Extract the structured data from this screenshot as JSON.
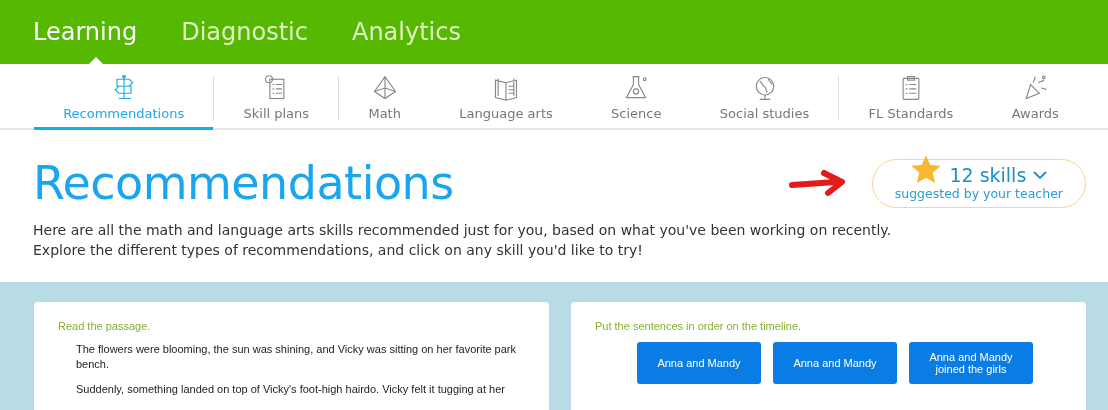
{
  "top_nav": [
    {
      "label": "Learning",
      "selected": true
    },
    {
      "label": "Diagnostic",
      "selected": false
    },
    {
      "label": "Analytics",
      "selected": false
    }
  ],
  "sub_nav": [
    {
      "items": [
        {
          "label": "Recommendations",
          "selected": true
        }
      ]
    },
    {
      "items": [
        {
          "label": "Skill plans",
          "selected": false
        }
      ]
    },
    {
      "items": [
        {
          "label": "Math",
          "selected": false
        },
        {
          "label": "Language arts",
          "selected": false
        },
        {
          "label": "Science",
          "selected": false
        },
        {
          "label": "Social studies",
          "selected": false
        }
      ]
    },
    {
      "items": [
        {
          "label": "FL Standards",
          "selected": false
        },
        {
          "label": "Awards",
          "selected": false
        }
      ]
    }
  ],
  "page_title": "Recommendations",
  "skills_badge": {
    "count": "12 skills",
    "caption": "suggested by your teacher"
  },
  "intro": [
    "Here are all the math and language arts skills recommended just for you, based on what you've been working on recently.",
    "Explore the different types of recommendations, and click on any skill you'd like to try!"
  ],
  "cards": [
    {
      "kind": "passage",
      "instruction": "Read the passage.",
      "paragraphs": [
        "The flowers were blooming, the sun was shining, and Vicky was sitting on her favorite park bench.",
        "Suddenly, something landed on top of Vicky's foot-high hairdo. Vicky felt it tugging at her"
      ]
    },
    {
      "kind": "timeline",
      "instruction": "Put the sentences in order on the timeline.",
      "options": [
        "Anna and Mandy",
        "Anna and Mandy",
        "Anna and Mandy joined the girls"
      ]
    }
  ]
}
